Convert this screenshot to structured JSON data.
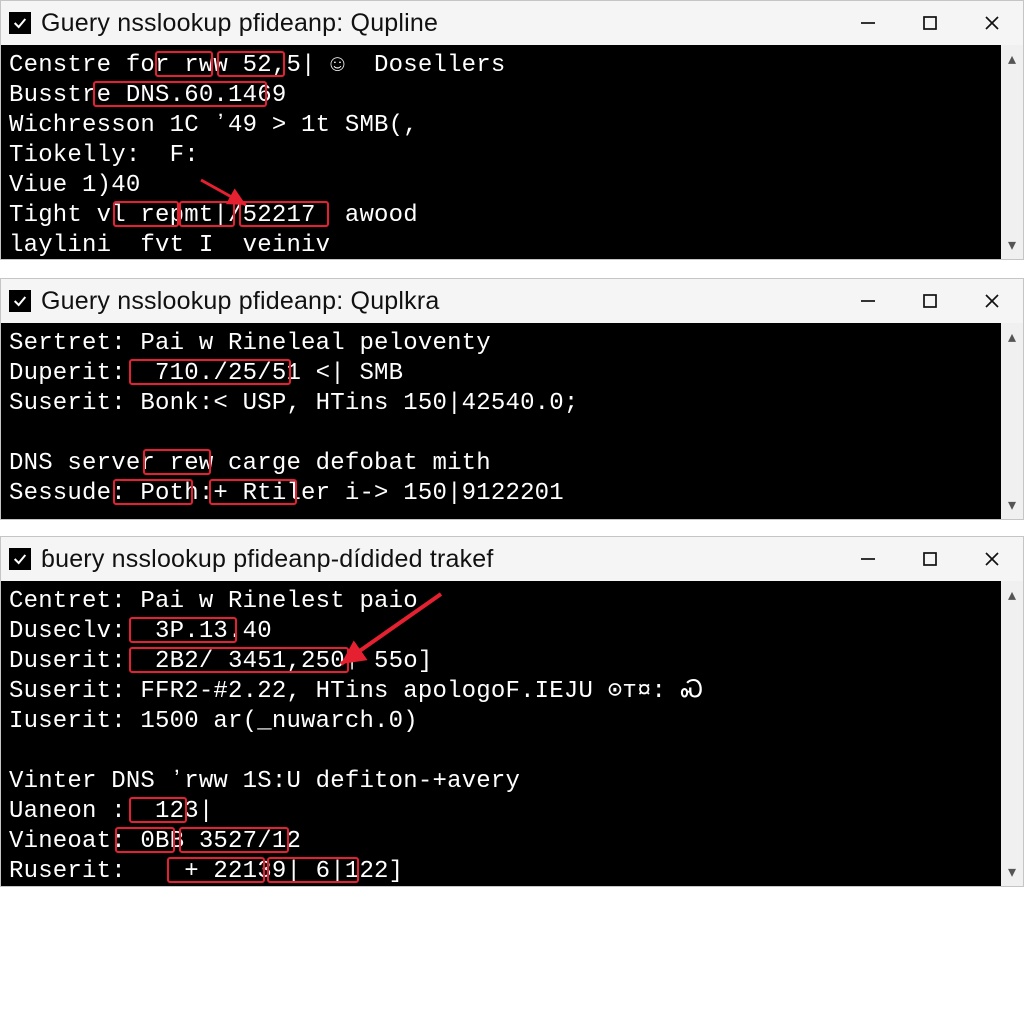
{
  "windows": [
    {
      "title": "Guery nsslookup pfideanp: Qupline",
      "lines": [
        "Censtre for rww 52,5| ☺  Dosellers",
        "Busstre DNS.60.1469",
        "Wichresson 1C ʼ49 > 1t SMB(,",
        "Tiokelly:  F:",
        "Viue 1)40",
        "Tight vl repmt|/52217  awood",
        "laylini  fvt I  veiniv"
      ]
    },
    {
      "title": "Guery nsslookup pfideanp: Quplkra",
      "lines": [
        "Sertret: Pai w Rineleal peloventy",
        "Duperit:  710./25/51 <| SMB",
        "Suserit: Bonk:< USP, HTins 150|42540.0;",
        "",
        "DNS server rew carge defobat mith",
        "Sessude: Poth:+ Rtiler i-> 150|9122201"
      ]
    },
    {
      "title": "ɓuery nsslookup pfideanp-dídided trakef",
      "lines": [
        "Centret: Pai w Rinelest paio",
        "Duseclv:  3P.13.40",
        "Duserit:  2B2/ 3451,250† 55o]",
        "Suserit: FFR2-#2.22, HTins apologoF.IEJU ⊙т¤: Ꮝ",
        "Iuserit: 1500 ar(_nuwarch.0)",
        "",
        "Vinter DNS ʼrww 1S:U defiton-+avery",
        "Uaneon :  123|",
        "Vineoat: 0BB 3527/12",
        "Ruserit:    + 22139| 6|122]"
      ]
    }
  ]
}
